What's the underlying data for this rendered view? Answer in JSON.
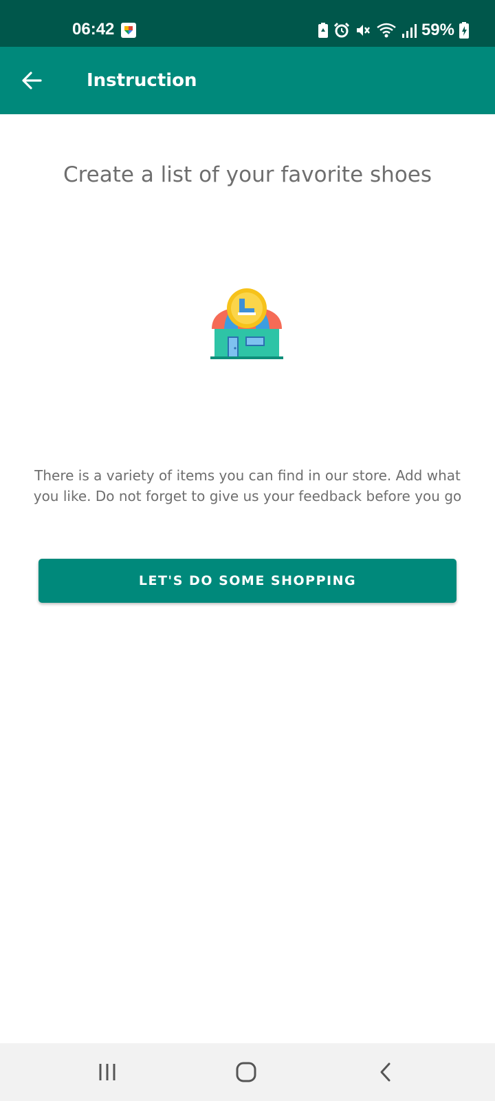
{
  "status_bar": {
    "time": "06:42",
    "battery": "59%",
    "icons": [
      "notification-icon",
      "battery-saver-icon",
      "alarm-icon",
      "mute-icon",
      "wifi-icon",
      "signal-icon",
      "battery-charging-icon"
    ]
  },
  "app_bar": {
    "title": "Instruction",
    "back_icon": "arrow-back-icon"
  },
  "main": {
    "heading": "Create a list of your favorite shoes",
    "illustration": "shoe-store-icon",
    "description": "There is a variety of items you can find in our store. Add what you like. Do not forget to give us your feedback before you go",
    "button_label": "LET'S DO SOME SHOPPING"
  },
  "nav_bar": {
    "icons": [
      "recent-apps-icon",
      "home-icon",
      "back-icon"
    ]
  },
  "colors": {
    "status_bar": "#00574b",
    "app_bar": "#00897b",
    "button": "#00897b",
    "text": "#6e6e6e",
    "nav_bar": "#f2f2f2"
  }
}
